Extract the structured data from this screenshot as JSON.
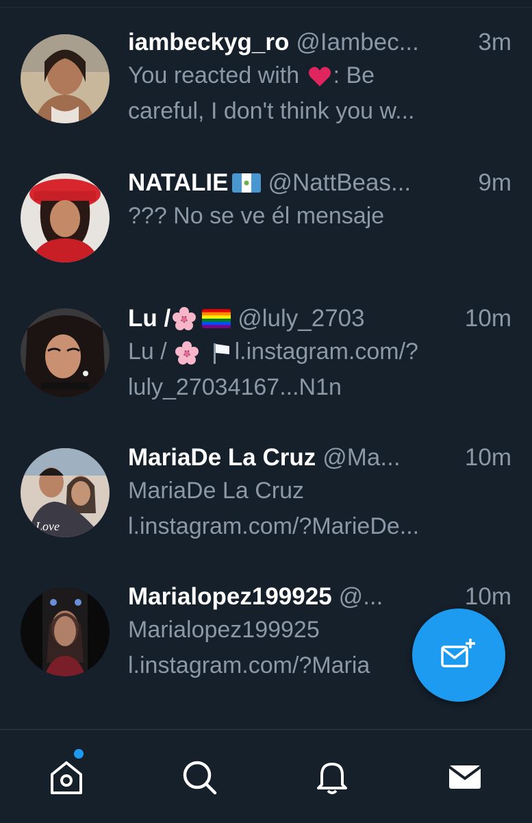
{
  "conversations": [
    {
      "name": "iambeckyg_ro",
      "handle": "@Iambec...",
      "time": "3m",
      "preview_line1_prefix": "You reacted with",
      "preview_line1_suffix": ": Be",
      "preview_line2": "careful, I don't think you w..."
    },
    {
      "name": "NATALIE",
      "handle": "@NattBeas...",
      "time": "9m",
      "preview_line1": "??? No se ve él mensaje"
    },
    {
      "name": "Lu /",
      "handle": "@luly_2703",
      "time": "10m",
      "preview_line1_prefix": "Lu /",
      "preview_line1_suffix": "l.instagram.com/?",
      "preview_line2": "luly_27034167...N1n"
    },
    {
      "name": "MariaDe La Cruz",
      "handle": "@Ma...",
      "time": "10m",
      "preview_line1": "MariaDe La Cruz",
      "preview_line2": "l.instagram.com/?MarieDe..."
    },
    {
      "name": "Marialopez199925",
      "handle": "@...",
      "time": "10m",
      "preview_line1": "Marialopez199925",
      "preview_line2": "l.instagram.com/?Maria"
    }
  ],
  "nav": {
    "items": [
      "home-icon",
      "search-icon",
      "bell-icon",
      "mail-icon"
    ],
    "active": "mail-icon"
  },
  "colors": {
    "background": "#15202b",
    "accent": "#1d9bf0",
    "secondary_text": "#8b98a5"
  }
}
